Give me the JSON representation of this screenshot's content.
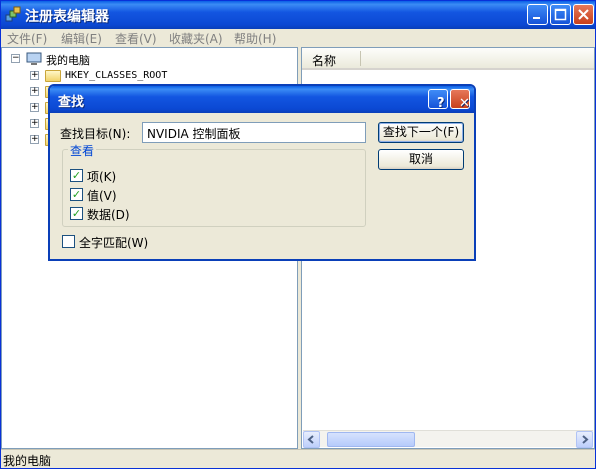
{
  "window": {
    "title": "注册表编辑器"
  },
  "menu": [
    {
      "label": "文件(F)"
    },
    {
      "label": "编辑(E)"
    },
    {
      "label": "查看(V)"
    },
    {
      "label": "收藏夹(A)"
    },
    {
      "label": "帮助(H)"
    }
  ],
  "tree": {
    "root_label": "我的电脑",
    "items": [
      {
        "label": "HKEY_CLASSES_ROOT"
      }
    ]
  },
  "list": {
    "column_name": "名称"
  },
  "status": {
    "text": "我的电脑"
  },
  "dialog": {
    "title": "查找",
    "help_symbol": "?",
    "close_symbol": "✕",
    "find_what_label": "查找目标(N):",
    "find_what_value": "NVIDIA 控制面板",
    "find_next_button": "查找下一个(F)",
    "cancel_button": "取消",
    "look_at_label": "查看",
    "options": [
      {
        "label": "项(K)",
        "checked": true
      },
      {
        "label": "值(V)",
        "checked": true
      },
      {
        "label": "数据(D)",
        "checked": true
      }
    ],
    "match_whole": {
      "label": "全字匹配(W)",
      "checked": false
    }
  },
  "colors": {
    "titlebar": "#0b48d3",
    "window_bg": "#ece9d8",
    "check_mark": "#21a121"
  }
}
